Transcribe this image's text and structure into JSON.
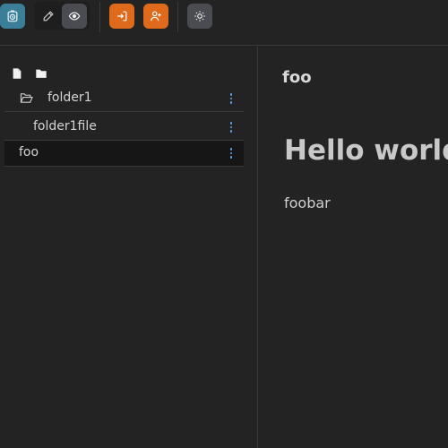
{
  "toolbar": {
    "buttons": [
      {
        "name": "app-logo",
        "icon": "timer-icon",
        "color": "#3a7f97"
      },
      {
        "name": "edit-mode",
        "icon": "pencil-icon"
      },
      {
        "name": "preview-mode",
        "icon": "eye-icon",
        "color": "#4a4c52"
      },
      {
        "name": "login",
        "icon": "login-icon",
        "color": "#e06a1b"
      },
      {
        "name": "add-user",
        "icon": "user-plus-icon",
        "color": "#e06a1b"
      },
      {
        "name": "theme",
        "icon": "sun-icon",
        "color": "#4a4c52"
      }
    ]
  },
  "sidebar": {
    "actions": [
      {
        "icon": "new-file-icon"
      },
      {
        "icon": "new-folder-icon"
      }
    ],
    "tree": [
      {
        "label": "folder1",
        "type": "folder",
        "icon": "folder-open-icon"
      },
      {
        "label": "folder1file",
        "type": "file"
      },
      {
        "label": "foo",
        "type": "file",
        "selected": true
      }
    ]
  },
  "document": {
    "title": "foo",
    "heading": "Hello world",
    "paragraph": "foobar"
  },
  "colors": {
    "background": "#232323",
    "accent_orange": "#e06a1b",
    "accent_teal": "#3a7f97",
    "kebab_blue": "#5ba3e6"
  }
}
